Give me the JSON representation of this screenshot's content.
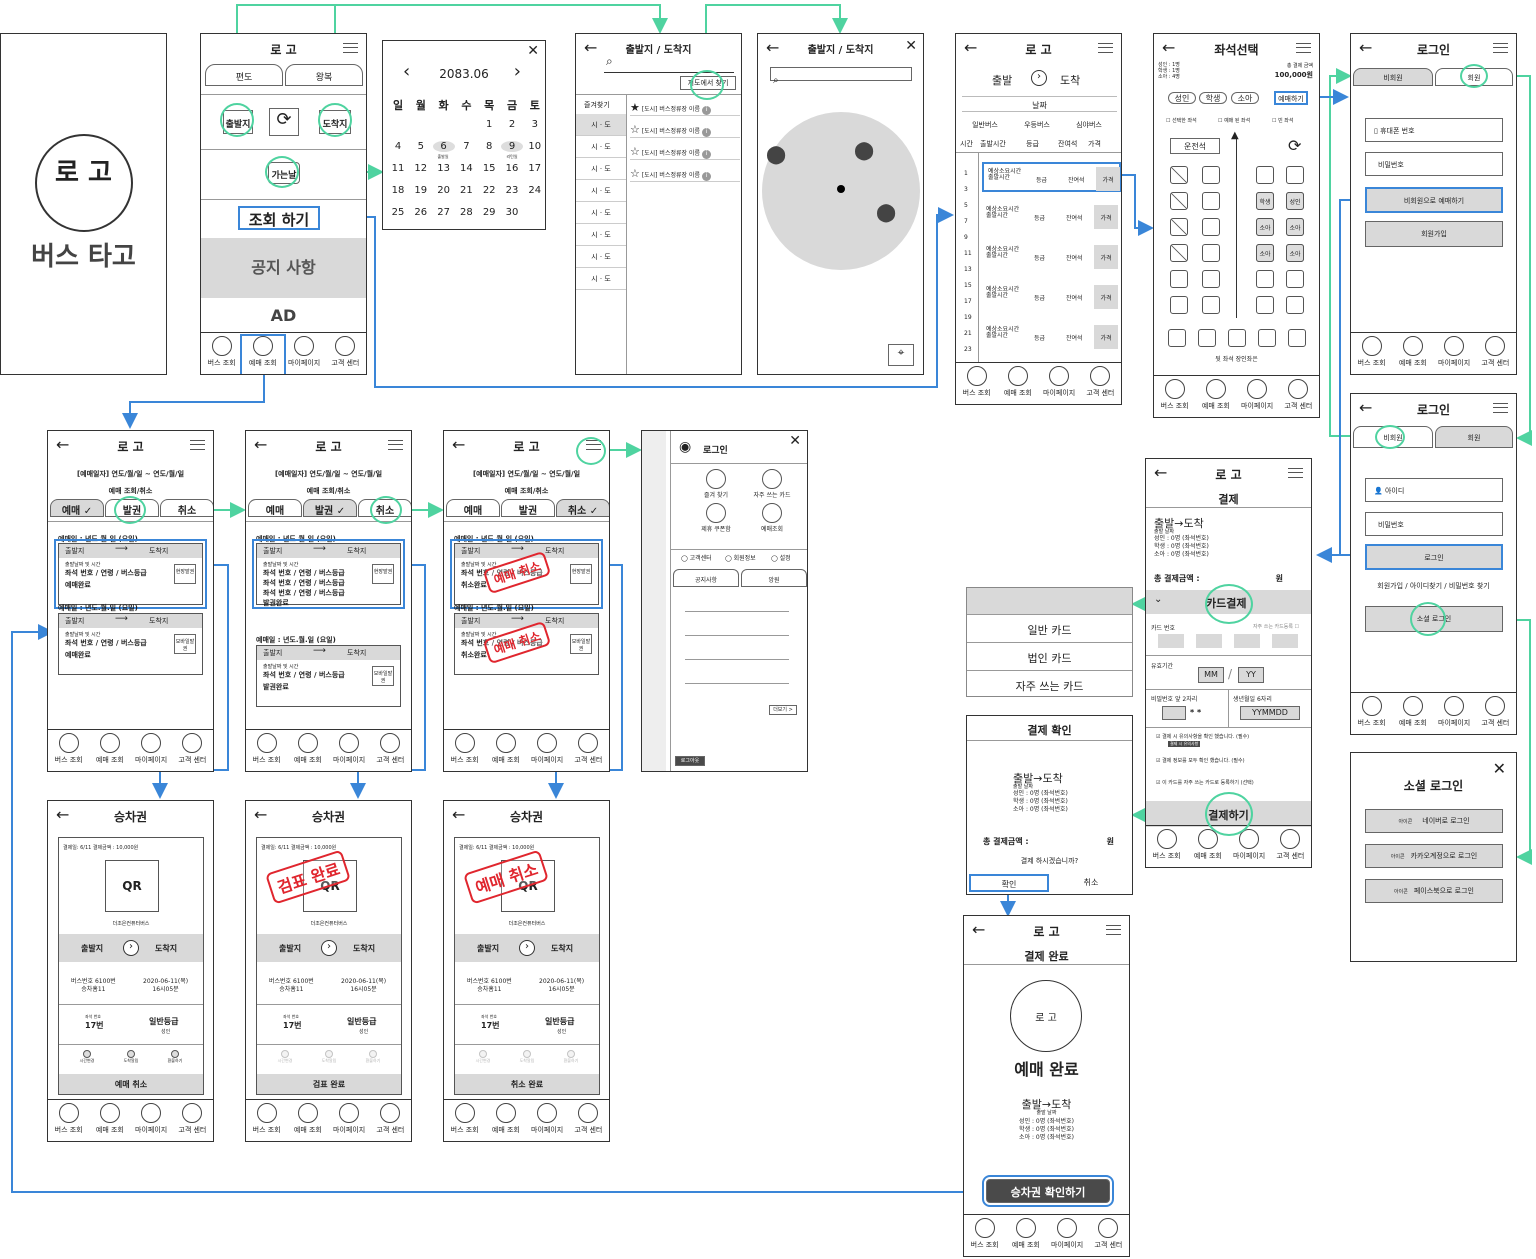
{
  "splash": {
    "logo": "로 고",
    "title": "버스 타고"
  },
  "nav": [
    "버스 조회",
    "예매 조회",
    "마이페이지",
    "고객 센터"
  ],
  "home": {
    "logo": "로 고",
    "tabs": [
      "편도",
      "왕복"
    ],
    "dep": "출발지",
    "arr": "도착지",
    "date": "가는날",
    "search": "조회 하기",
    "notice": "공지 사항",
    "ad": "AD"
  },
  "calendar": {
    "month": "2083.06",
    "weekdays": [
      "일",
      "월",
      "화",
      "수",
      "목",
      "금",
      "토"
    ],
    "rows": [
      [
        "",
        "",
        "",
        "",
        "1",
        "2",
        "3"
      ],
      [
        "4",
        "5",
        "6",
        "7",
        "8",
        "9",
        "10"
      ],
      [
        "11",
        "12",
        "13",
        "14",
        "15",
        "16",
        "17"
      ],
      [
        "18",
        "19",
        "20",
        "21",
        "22",
        "23",
        "24"
      ],
      [
        "25",
        "26",
        "27",
        "28",
        "29",
        "30",
        ""
      ]
    ],
    "notes": [
      "출발일",
      "리턴일"
    ]
  },
  "terminal": {
    "title": "출발지 / 도착지",
    "map_btn": "지도에서 찾기",
    "fav": "즐겨찾기",
    "region": "시 · 도",
    "item": "[도시] 버스정류장 이름"
  },
  "map": {
    "title": "출발지 / 도착지"
  },
  "times": {
    "logo": "로 고",
    "dep": "출발",
    "arr": "도착",
    "date": "날짜",
    "grades": [
      "일반버스",
      "우등버스",
      "심야버스"
    ],
    "cols": [
      "시간",
      "출발시간",
      "등급",
      "잔여석",
      "가격"
    ],
    "hours": [
      "1",
      "3",
      "5",
      "7",
      "9",
      "11",
      "13",
      "15",
      "17",
      "19",
      "21",
      "23"
    ],
    "row_time": "예상소요시간 출발시간",
    "row_grade": "등급",
    "row_left": "잔여석",
    "row_price": "가격"
  },
  "seat": {
    "title": "좌석선택",
    "info_l": [
      "성인 : 1명",
      "학생 : 1명",
      "소아 : 4명"
    ],
    "info_r_l": "총 결제 금액",
    "info_r_v": "100,000원",
    "types": [
      "성인",
      "학생",
      "소아"
    ],
    "reserve": "예매하기",
    "legend": [
      "선택한 좌석",
      "예매 된 좌석",
      "빈 좌석"
    ],
    "driver": "운전석",
    "labels": [
      "학생",
      "성인",
      "소아",
      "소아",
      "소아",
      "소아"
    ],
    "back": "뒷 좌석 장인좌은"
  },
  "login1": {
    "title": "로그인",
    "tabs": [
      "비회원",
      "회원"
    ],
    "phone": "휴대폰 번호",
    "pw": "비밀번호",
    "book": "비회원으로 예매하기",
    "join": "회원가입"
  },
  "login2": {
    "title": "로그인",
    "tabs": [
      "비회원",
      "회원"
    ],
    "id": "아이디",
    "pw": "비밀번호",
    "login": "로그인",
    "links": "회원가입 / 아이디찾기 / 비밀번호 찾기",
    "social": "소셜 로그인"
  },
  "social": {
    "title": "소셜 로그인",
    "items": [
      "네이버로 로그인",
      "카카오계정으로 로그인",
      "페이스북으로 로그인"
    ],
    "icon": "아이콘"
  },
  "pay": {
    "logo": "로 고",
    "title": "결제",
    "route": "출발→도착",
    "sub": "출발 날짜",
    "people": [
      "성인 : 0명 (좌석번호)",
      "학생 : 0명 (좌석번호)",
      "소아 : 0명 (좌석번호)"
    ],
    "total_l": "총 결제금액 :",
    "total_r": "원",
    "card": "카드결제",
    "card_no": "카드 번호",
    "reg": "자주 쓰는 카드등록",
    "exp": "유효기간",
    "mm": "MM",
    "yy": "YY",
    "pw2": "비밀번호 앞 2자리",
    "birth": "생년월일 6자리",
    "stars": "* *",
    "yymmdd": "YYMMDD",
    "checks": [
      "결제 시 유의사항을 확인 했습니다. (필수)",
      "결제 정보를 모두 확인 했습니다. (필수)",
      "이 카드를 자주 쓰는 카드로 등록하기 (선택)"
    ],
    "check_tag": "결제 시 유의사항",
    "submit": "결제하기"
  },
  "card_menu": [
    "일반 카드",
    "법인 카드",
    "자주 쓰는 카드"
  ],
  "confirm": {
    "title": "결제 확인",
    "route": "출발→도착",
    "sub": "출발 날짜",
    "people": [
      "성인 : 0명 (좌석번호)",
      "학생 : 0명 (좌석번호)",
      "소아 : 0명 (좌석번호)"
    ],
    "total_l": "총 결제금액 :",
    "total_r": "원",
    "q": "결제 하시겠습니까?",
    "ok": "확인",
    "cancel": "취소"
  },
  "done": {
    "logo": "로 고",
    "title": "결제 완료",
    "circle": "로 고",
    "msg": "예매 완료",
    "route": "출발→도착",
    "sub": "출발 날짜",
    "people": [
      "성인 : 0명 (좌석번호)",
      "학생 : 0명 (좌석번호)",
      "소아 : 0명 (좌석번호)"
    ],
    "ticket": "승차권 확인하기"
  },
  "history": {
    "logo": "로 고",
    "range": "[예매일자] 연도/월/일 ~ 연도/월/일",
    "sub": "예매 조회/취소",
    "tabs": [
      "예매",
      "발권",
      "취소"
    ],
    "date": "예매일 : 년도.월.일 (요일)",
    "dep": "출발지",
    "arr": "도착지",
    "line1": "출발날짜 및 시간",
    "line2": "좌석 번호 / 연령 / 버스등급",
    "st1": "예매완료",
    "st2": "발권완료",
    "st3": "취소완료",
    "btn1": "현장발권",
    "btn2": "모바일발권",
    "cancel_stamp": "예매 취소"
  },
  "drawer": {
    "login": "로그인",
    "items": [
      "즐겨 찾기",
      "자주 쓰는 카드",
      "제휴 쿠폰함",
      "예매조회"
    ],
    "radios": [
      "고객센터",
      "회원정보",
      "설정"
    ],
    "tabs": [
      "공지사항",
      "앙원"
    ],
    "more": "더보기 >",
    "logout": "로그아웃"
  },
  "ticket": {
    "title": "승차권",
    "pay": "결제일: 6/11  결제금액 : 10,000원",
    "qr": "QR",
    "company": "더조은컨퓨터버스",
    "dep": "출발지",
    "arr": "도착지",
    "bus": "버스번호 6100번",
    "plate": "승차홈11",
    "dt": "2020-06-11(목)",
    "tm": "16시05분",
    "seat_l": "좌석 번호",
    "seat": "17번",
    "grade": "일반등급",
    "age": "성인",
    "opts": [
      "시간변경",
      "도착알림",
      "환불하기"
    ],
    "btn1": "예매 취소",
    "btn2": "검표 완료",
    "btn3": "취소 완료",
    "stamp2": "검표 완료",
    "stamp3": "예매 취소"
  }
}
